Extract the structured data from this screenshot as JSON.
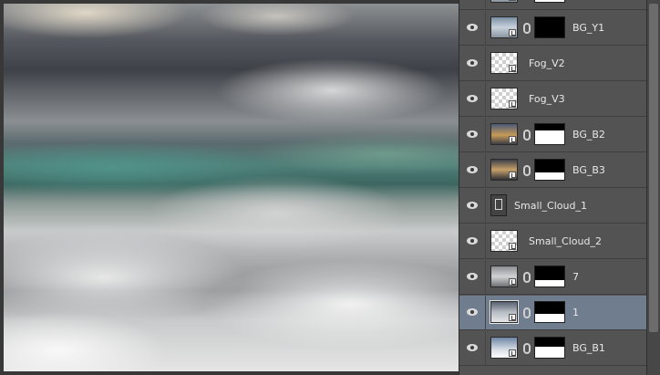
{
  "panel": {
    "layers": [
      {
        "name": "",
        "visible": true,
        "thumb": "sky-blue",
        "has_mask": true,
        "mask_fill": 0.45,
        "selected": false,
        "partial": true
      },
      {
        "name": "BG_Y1",
        "visible": true,
        "thumb": "sky-blue",
        "has_mask": true,
        "mask_fill": 0.0,
        "selected": false
      },
      {
        "name": "Fog_V2",
        "visible": true,
        "thumb": "transparent",
        "has_mask": false,
        "selected": false
      },
      {
        "name": "Fog_V3",
        "visible": true,
        "thumb": "transparent",
        "has_mask": false,
        "selected": false
      },
      {
        "name": "BG_B2",
        "visible": true,
        "thumb": "sunset",
        "has_mask": true,
        "mask_fill": 0.7,
        "selected": false
      },
      {
        "name": "BG_B3",
        "visible": true,
        "thumb": "sunset2",
        "has_mask": true,
        "mask_fill": 0.35,
        "selected": false
      },
      {
        "name": "Small_Cloud_1",
        "visible": true,
        "thumb": "document",
        "has_mask": false,
        "selected": false
      },
      {
        "name": "Small_Cloud_2",
        "visible": true,
        "thumb": "transparent",
        "has_mask": false,
        "selected": false
      },
      {
        "name": "7",
        "visible": true,
        "thumb": "grey",
        "has_mask": true,
        "mask_fill": 0.3,
        "selected": false
      },
      {
        "name": "1",
        "visible": true,
        "thumb": "clouds",
        "has_mask": true,
        "mask_fill": 0.4,
        "selected": true
      },
      {
        "name": "BG_B1",
        "visible": true,
        "thumb": "blue2",
        "has_mask": true,
        "mask_fill": 0.55,
        "selected": false
      }
    ]
  },
  "colors": {
    "panel_bg": "#535353",
    "selected_row": "#6f7d8f",
    "text": "#e8e8e8"
  }
}
